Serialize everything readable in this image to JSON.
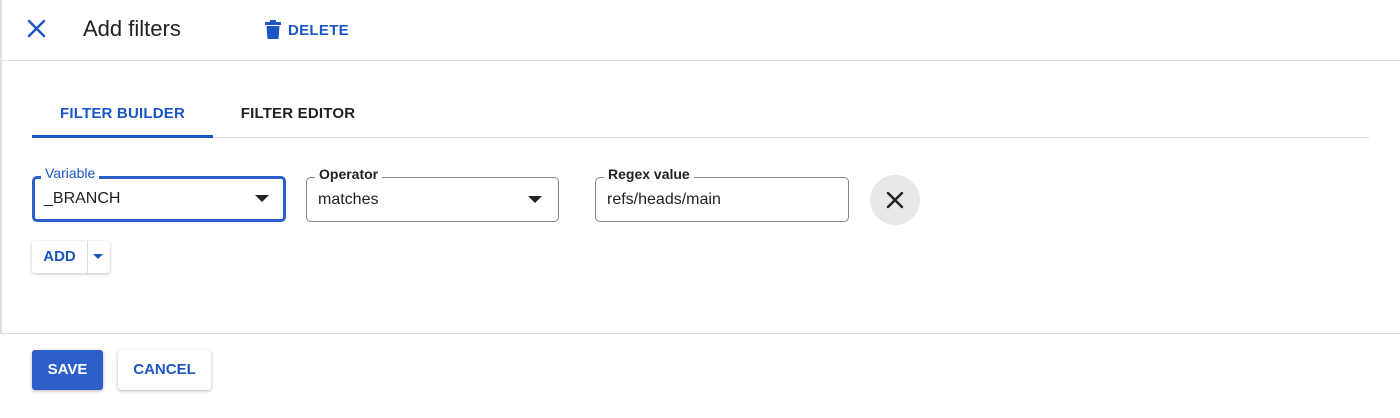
{
  "header": {
    "title": "Add filters",
    "close_icon": "close-icon",
    "delete_label": "DELETE",
    "delete_icon": "trash-icon"
  },
  "tabs": [
    {
      "label": "FILTER BUILDER",
      "active": true
    },
    {
      "label": "FILTER EDITOR",
      "active": false
    }
  ],
  "filter_row": {
    "variable": {
      "label": "Variable",
      "value": "_BRANCH"
    },
    "operator": {
      "label": "Operator",
      "value": "matches"
    },
    "regex": {
      "label": "Regex value",
      "value": "refs/heads/main"
    },
    "remove_icon": "close-icon"
  },
  "add_button": {
    "label": "ADD",
    "icon": "chevron-down-icon"
  },
  "footer": {
    "save_label": "SAVE",
    "cancel_label": "CANCEL"
  },
  "colors": {
    "accent": "#1a56c4",
    "primary_button": "#2d5fc9",
    "text": "#202124",
    "divider": "#dadce0"
  }
}
